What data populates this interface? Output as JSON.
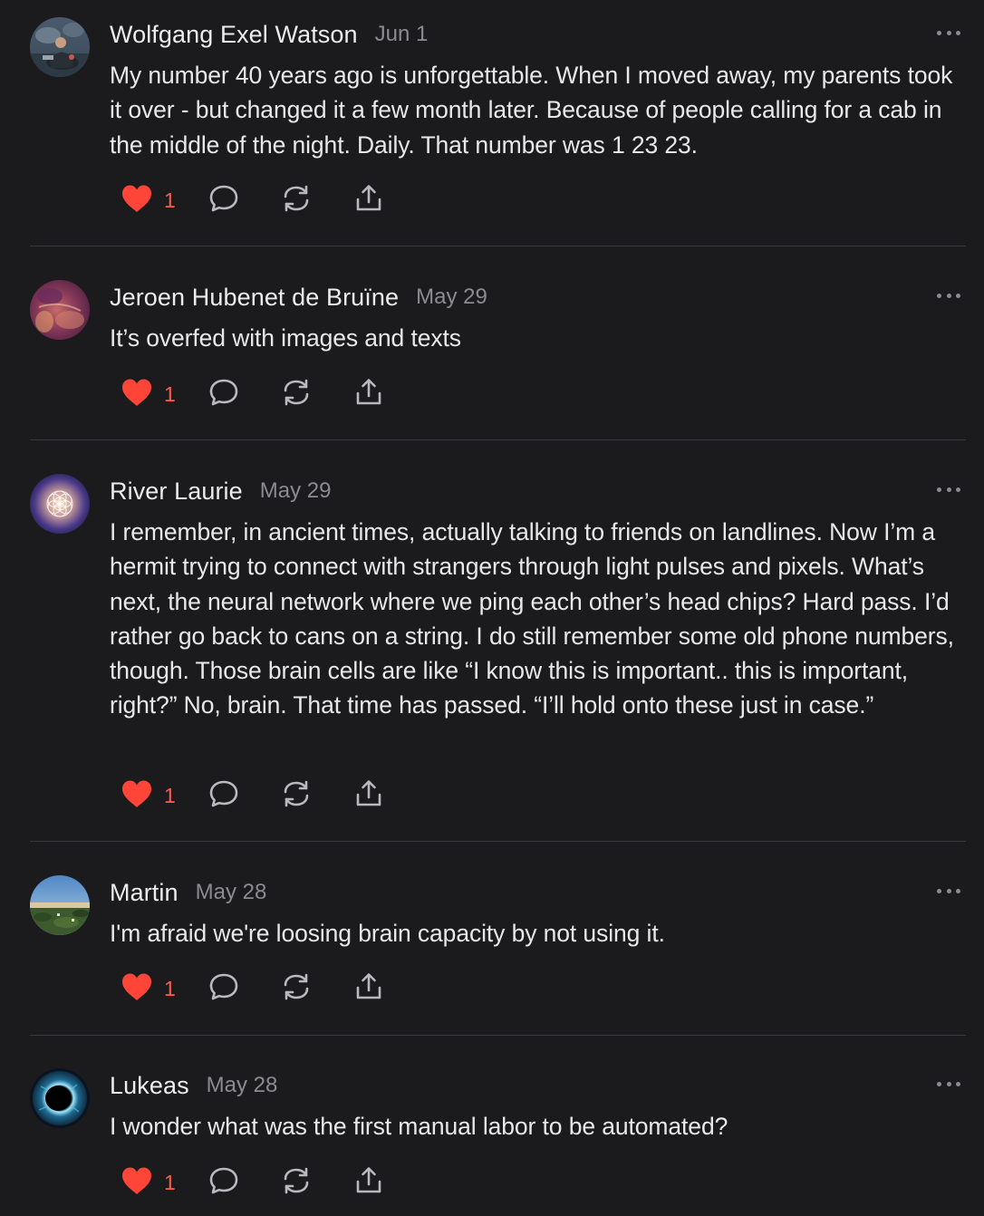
{
  "colors": {
    "background": "#1b1b1d",
    "text": "#e8e8ea",
    "meta": "#8b8b90",
    "like": "#ff4538",
    "divider": "#38383c"
  },
  "comments": [
    {
      "author": "Wolfgang Exel Watson",
      "date": "Jun 1",
      "text": "My number 40 years ago is unforgettable. When I moved away, my parents took it over - but changed it a few month later. Because of people calling for a cab in the middle of the night. Daily. That number was 1 23 23.",
      "likes": "1",
      "avatar_icon": "avatar-photo-person"
    },
    {
      "author": "Jeroen Hubenet de Bruïne",
      "date": "May 29",
      "text": "It’s overfed with images and texts",
      "likes": "1",
      "avatar_icon": "avatar-abstract-art"
    },
    {
      "author": "River Laurie",
      "date": "May 29",
      "text": "I remember, in ancient times, actually talking to friends on landlines. Now I’m a hermit trying to connect with strangers through light pulses and pixels. What’s next, the neural network where we ping each other’s head chips? Hard pass. I’d rather go back to cans on a string. I do still remember some old phone numbers, though. Those brain cells are like “I know this is important.. this is important, right?” No, brain. That time has passed. “I’ll hold onto these just in case.”",
      "likes": "1",
      "avatar_icon": "avatar-flower-of-life"
    },
    {
      "author": "Martin",
      "date": "May 28",
      "text": "I'm afraid we're loosing brain capacity by not using it.",
      "likes": "1",
      "avatar_icon": "avatar-landscape"
    },
    {
      "author": "Lukeas",
      "date": "May 28",
      "text": "I wonder what was the first manual labor to be automated?",
      "likes": "1",
      "avatar_icon": "avatar-eclipse"
    }
  ],
  "action_icons": [
    "heart-icon",
    "comment-icon",
    "restack-icon",
    "share-icon"
  ]
}
